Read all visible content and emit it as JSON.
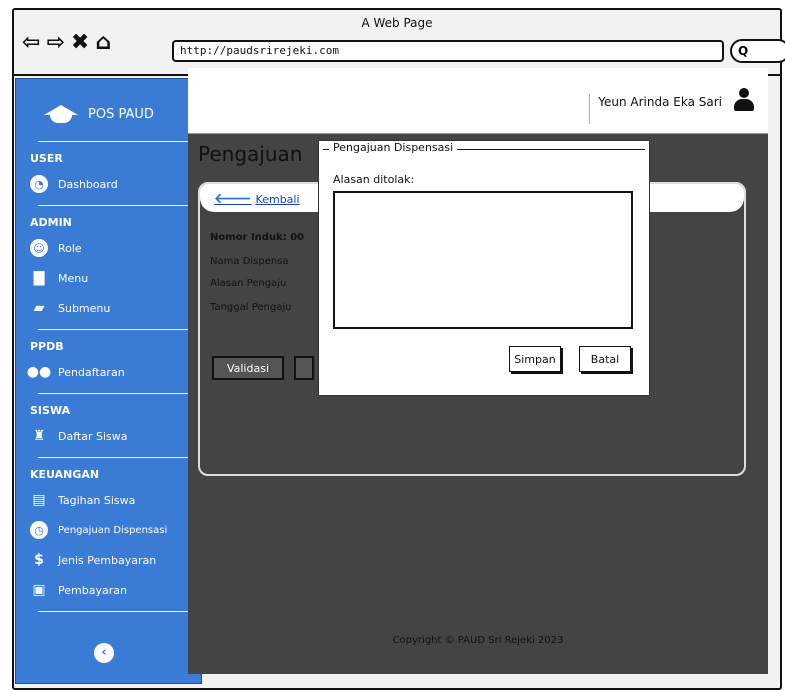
{
  "browser": {
    "title": "A Web Page",
    "url": "http://paudsrirejeki.com",
    "nav": {
      "back": "⇦",
      "forward": "⇨",
      "stop": "✖",
      "home": "⌂"
    },
    "search_icon": "Q"
  },
  "sidebar": {
    "brand": "POS PAUD",
    "sections": {
      "user": "USER",
      "admin": "ADMIN",
      "ppdb": "PPDB",
      "siswa": "SISWA",
      "keuangan": "KEUANGAN"
    },
    "items": {
      "dashboard": "Dashboard",
      "role": "Role",
      "menu": "Menu",
      "submenu": "Submenu",
      "pendaftaran": "Pendaftaran",
      "daftar_siswa": "Daftar Siswa",
      "tagihan_siswa": "Tagihan Siswa",
      "pengajuan_dispensasi": "Pengajuan Dispensasi",
      "jenis_pembayaran": "Jenis Pembayaran",
      "pembayaran": "Pembayaran"
    }
  },
  "topbar": {
    "user_name": "Yeun Arinda Eka Sari"
  },
  "main": {
    "page_title": "Pengajuan",
    "back_label": "Kembali",
    "fields": {
      "nomor_induk": "Nomor Induk: 00",
      "nama": "Nama Dispensa",
      "alasan": "Alasan Pengaju",
      "tanggal": "Tanggal Pengaju"
    },
    "validasi_label": "Validasi",
    "footer": "Copyright © PAUD Sri Rejeki 2023"
  },
  "modal": {
    "legend": "Pengajuan Dispensasi",
    "label": "Alasan ditolak:",
    "textarea_value": "",
    "simpan_label": "Simpan",
    "batal_label": "Batal"
  }
}
